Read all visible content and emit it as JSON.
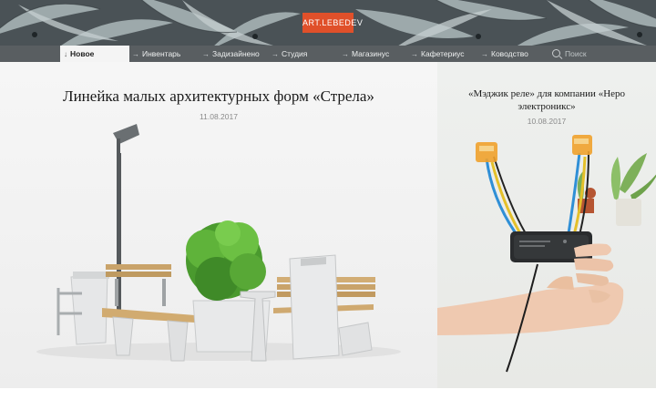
{
  "logo": {
    "text": "ART.LEBEDEV"
  },
  "nav": {
    "items": [
      {
        "label": "Новое",
        "active": true
      },
      {
        "label": "Инвентарь"
      },
      {
        "label": "Задизайнено"
      },
      {
        "label": "Студия"
      },
      {
        "label": "Магазинус"
      },
      {
        "label": "Кафетериус"
      },
      {
        "label": "Ководство"
      }
    ],
    "search_placeholder": "Поиск"
  },
  "features": {
    "main": {
      "title": "Линейка малых архитектурных форм «Стрела»",
      "date": "11.08.2017"
    },
    "side": {
      "title_line1": "«Мэджик реле» для компании «Неро",
      "title_line2": "электроникс»",
      "date": "10.08.2017"
    }
  },
  "colors": {
    "logo": "#e0502a",
    "nav": "#595e61",
    "banner": "#4a5256"
  },
  "icons": {
    "nav_arrow": "arrow-right-icon",
    "active_arrow": "arrow-down-icon",
    "search": "search-icon"
  }
}
